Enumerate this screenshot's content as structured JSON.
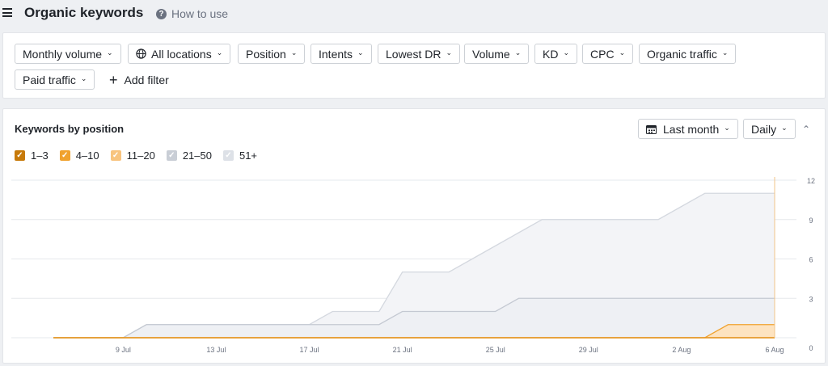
{
  "header": {
    "title": "Organic keywords",
    "help_label": "How to use"
  },
  "filters": {
    "chips": [
      {
        "label": "Monthly volume",
        "icon": "chevron-down-icon"
      },
      {
        "label": "All locations",
        "icon": "globe-icon"
      },
      {
        "label": "Position",
        "icon": "chevron-down-icon"
      },
      {
        "label": "Intents",
        "icon": "chevron-down-icon"
      },
      {
        "label": "Lowest DR",
        "icon": "chevron-down-icon"
      },
      {
        "label": "Volume",
        "icon": "chevron-down-icon"
      },
      {
        "label": "KD",
        "icon": "chevron-down-icon"
      },
      {
        "label": "CPC",
        "icon": "chevron-down-icon"
      },
      {
        "label": "Organic traffic",
        "icon": "chevron-down-icon"
      },
      {
        "label": "Paid traffic",
        "icon": "chevron-down-icon"
      }
    ],
    "add_filter_label": "Add filter"
  },
  "card": {
    "title": "Keywords by position",
    "range_label": "Last month",
    "granularity_label": "Daily"
  },
  "legend": [
    {
      "label": "1–3",
      "color": "#c77a0a",
      "checked": true
    },
    {
      "label": "4–10",
      "color": "#f0a22e",
      "checked": true
    },
    {
      "label": "11–20",
      "color": "#f8c47f",
      "checked": true
    },
    {
      "label": "21–50",
      "color": "#c9ced6",
      "checked": true
    },
    {
      "label": "51+",
      "color": "#dde1e7",
      "checked": true
    }
  ],
  "chart_data": {
    "type": "area",
    "stacked": true,
    "x_tick_labels": [
      "9 Jul",
      "13 Jul",
      "17 Jul",
      "21 Jul",
      "25 Jul",
      "29 Jul",
      "2 Aug",
      "6 Aug"
    ],
    "y_ticks": [
      0,
      3,
      6,
      9,
      12
    ],
    "ylim": [
      0,
      12
    ],
    "x": [
      "6 Jul",
      "7 Jul",
      "8 Jul",
      "9 Jul",
      "10 Jul",
      "11 Jul",
      "12 Jul",
      "13 Jul",
      "14 Jul",
      "15 Jul",
      "16 Jul",
      "17 Jul",
      "18 Jul",
      "19 Jul",
      "20 Jul",
      "21 Jul",
      "22 Jul",
      "23 Jul",
      "24 Jul",
      "25 Jul",
      "26 Jul",
      "27 Jul",
      "28 Jul",
      "29 Jul",
      "30 Jul",
      "31 Jul",
      "1 Aug",
      "2 Aug",
      "3 Aug",
      "4 Aug",
      "5 Aug",
      "6 Aug"
    ],
    "series": [
      {
        "name": "1–3",
        "values": [
          0,
          0,
          0,
          0,
          0,
          0,
          0,
          0,
          0,
          0,
          0,
          0,
          0,
          0,
          0,
          0,
          0,
          0,
          0,
          0,
          0,
          0,
          0,
          0,
          0,
          0,
          0,
          0,
          0,
          0,
          0,
          0
        ]
      },
      {
        "name": "4–10",
        "values": [
          0,
          0,
          0,
          0,
          0,
          0,
          0,
          0,
          0,
          0,
          0,
          0,
          0,
          0,
          0,
          0,
          0,
          0,
          0,
          0,
          0,
          0,
          0,
          0,
          0,
          0,
          0,
          0,
          0,
          0,
          0,
          0
        ]
      },
      {
        "name": "11–20",
        "values": [
          0,
          0,
          0,
          0,
          0,
          0,
          0,
          0,
          0,
          0,
          0,
          0,
          0,
          0,
          0,
          0,
          0,
          0,
          0,
          0,
          0,
          0,
          0,
          0,
          0,
          0,
          0,
          0,
          0,
          1,
          1,
          1
        ]
      },
      {
        "name": "21–50",
        "values": [
          0,
          0,
          0,
          0,
          1,
          1,
          1,
          1,
          1,
          1,
          1,
          1,
          1,
          1,
          1,
          2,
          2,
          2,
          2,
          2,
          3,
          3,
          3,
          3,
          3,
          3,
          3,
          3,
          3,
          2,
          2,
          2
        ]
      },
      {
        "name": "51+",
        "values": [
          0,
          0,
          0,
          0,
          0,
          0,
          0,
          0,
          0,
          0,
          0,
          0,
          1,
          1,
          1,
          3,
          3,
          3,
          4,
          5,
          5,
          6,
          6,
          6,
          6,
          6,
          6,
          7,
          8,
          8,
          8,
          8
        ]
      }
    ]
  }
}
